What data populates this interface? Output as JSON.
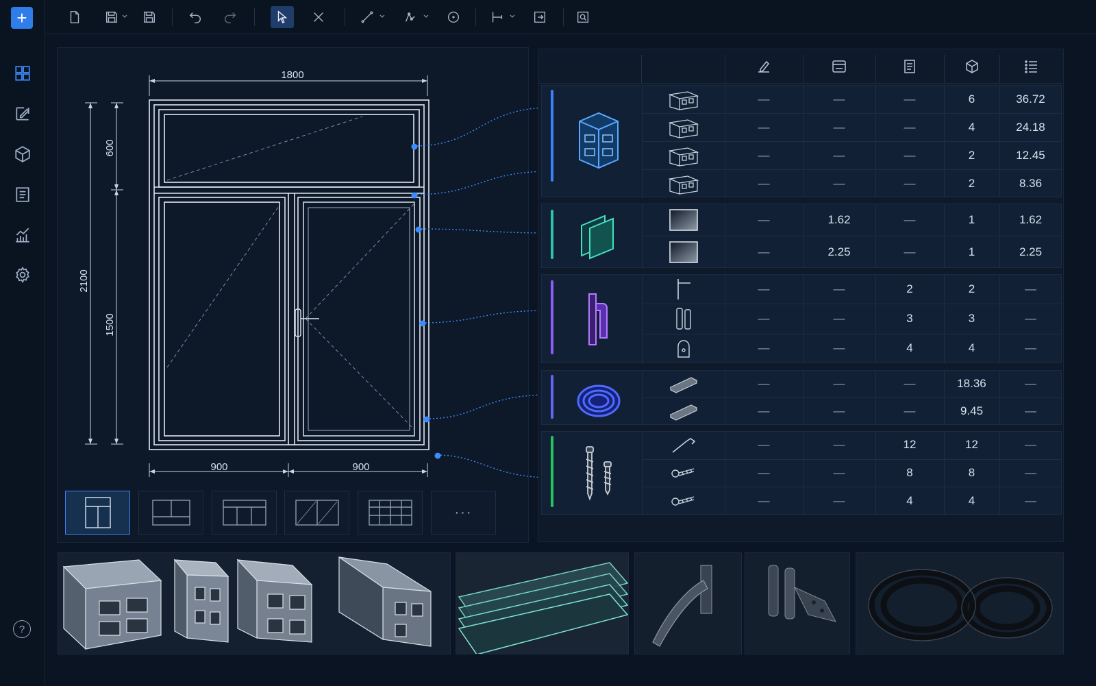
{
  "sidebar": {
    "add_label": "+",
    "items": [
      "dashboard-icon",
      "edit-icon",
      "cube-icon",
      "report-icon",
      "chart-icon",
      "settings-icon"
    ],
    "help_label": "?"
  },
  "toolbar": {
    "tools": [
      "new-file-icon",
      "save-as-icon",
      "save-icon",
      "undo-icon",
      "redo-icon",
      "select-icon",
      "trim-icon",
      "line-icon",
      "node-icon",
      "circle-icon",
      "dimension-icon",
      "export-icon",
      "preview-icon"
    ],
    "active": "select-icon"
  },
  "drawing": {
    "width_total": "1800",
    "height_total": "2100",
    "height_top": "600",
    "height_bottom": "1500",
    "width_left": "900",
    "width_right": "900"
  },
  "layouts": {
    "more_label": "···",
    "active_index": 0
  },
  "table": {
    "header_icons": [
      "edit-pen-icon",
      "area-icon",
      "document-icon",
      "quantity-box-icon",
      "list-icon"
    ],
    "groups": [
      {
        "name": "profiles",
        "color": "#3b82f6",
        "rows": [
          {
            "c1": "—",
            "c2": "—",
            "c3": "—",
            "c4": "6",
            "c5": "36.72"
          },
          {
            "c1": "—",
            "c2": "—",
            "c3": "—",
            "c4": "4",
            "c5": "24.18"
          },
          {
            "c1": "—",
            "c2": "—",
            "c3": "—",
            "c4": "2",
            "c5": "12.45"
          },
          {
            "c1": "—",
            "c2": "—",
            "c3": "—",
            "c4": "2",
            "c5": "8.36"
          }
        ]
      },
      {
        "name": "glass",
        "color": "#2cc3a8",
        "rows": [
          {
            "c1": "—",
            "c2": "1.62",
            "c3": "—",
            "c4": "1",
            "c5": "1.62"
          },
          {
            "c1": "—",
            "c2": "2.25",
            "c3": "—",
            "c4": "1",
            "c5": "2.25"
          }
        ]
      },
      {
        "name": "hardware",
        "color": "#8b5cf6",
        "rows": [
          {
            "c1": "—",
            "c2": "—",
            "c3": "2",
            "c4": "2",
            "c5": "—"
          },
          {
            "c1": "—",
            "c2": "—",
            "c3": "3",
            "c4": "3",
            "c5": "—"
          },
          {
            "c1": "—",
            "c2": "—",
            "c3": "4",
            "c4": "4",
            "c5": "—"
          }
        ]
      },
      {
        "name": "seals",
        "color": "#6366f1",
        "rows": [
          {
            "c1": "—",
            "c2": "—",
            "c3": "—",
            "c4": "18.36",
            "c5": "—"
          },
          {
            "c1": "—",
            "c2": "—",
            "c3": "—",
            "c4": "9.45",
            "c5": "—"
          }
        ]
      },
      {
        "name": "fasteners",
        "color": "#22c55e",
        "rows": [
          {
            "c1": "—",
            "c2": "—",
            "c3": "12",
            "c4": "12",
            "c5": "—"
          },
          {
            "c1": "—",
            "c2": "—",
            "c3": "8",
            "c4": "8",
            "c5": "—"
          },
          {
            "c1": "—",
            "c2": "—",
            "c3": "4",
            "c4": "4",
            "c5": "—"
          }
        ]
      }
    ]
  },
  "colors": {
    "accent": "#2f7de8",
    "connector": "#3b8cff",
    "background": "#0b1422"
  }
}
